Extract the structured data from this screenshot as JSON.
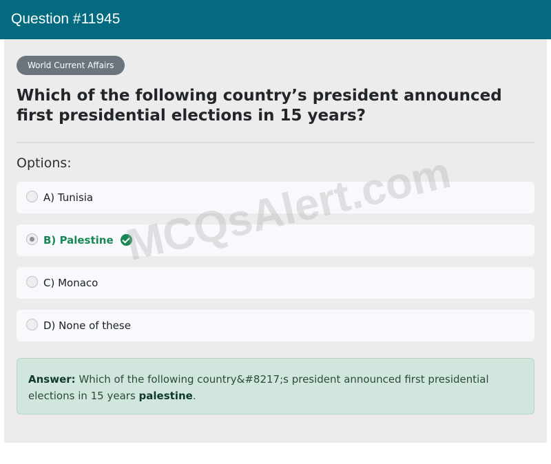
{
  "header": {
    "title": "Question #11945"
  },
  "question": {
    "category": "World Current Affairs",
    "text": "Which of the following country’s president announced first presidential elections in 15 years?"
  },
  "options_title": "Options:",
  "options": [
    {
      "label": "A) Tunisia",
      "selected": false,
      "correct": false
    },
    {
      "label": "B) Palestine",
      "selected": true,
      "correct": true
    },
    {
      "label": "C) Monaco",
      "selected": false,
      "correct": false
    },
    {
      "label": "D) None of these",
      "selected": false,
      "correct": false
    }
  ],
  "answer": {
    "prefix": "Answer:",
    "text": "Which of the following country&#8217;s president announced first presidential elections in 15 years",
    "value": "palestine",
    "suffix": "."
  },
  "watermark": "MCQsAlert.com",
  "colors": {
    "header_bg": "#046a80",
    "correct": "#198754",
    "answer_bg": "#d1e7dd",
    "tag_bg": "#6c757d"
  }
}
